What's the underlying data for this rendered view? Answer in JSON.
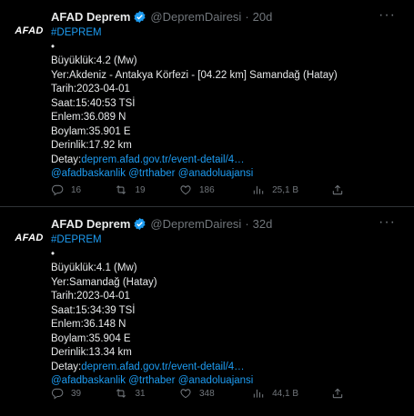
{
  "tweets": [
    {
      "avatar_text": "AFAD",
      "name": "AFAD Deprem",
      "handle": "@DepremDairesi",
      "sep": "·",
      "time": "20d",
      "more": "···",
      "hashtag": "#DEPREM",
      "bullet": "•",
      "lines": [
        "Büyüklük:4.2 (Mw)",
        "Yer:Akdeniz - Antakya Körfezi - [04.22 km] Samandağ (Hatay)",
        "Tarih:2023-04-01",
        "Saat:15:40:53 TSİ",
        "Enlem:36.089 N",
        "Boylam:35.901 E",
        "Derinlik:17.92 km"
      ],
      "detail_label": "Detay:",
      "detail_link": "deprem.afad.gov.tr/event-detail/4…",
      "mentions": "@afadbaskanlik @trthaber @anadoluajansi",
      "replies": "16",
      "retweets": "19",
      "likes": "186",
      "views": "25,1 B"
    },
    {
      "avatar_text": "AFAD",
      "name": "AFAD Deprem",
      "handle": "@DepremDairesi",
      "sep": "·",
      "time": "32d",
      "more": "···",
      "hashtag": "#DEPREM",
      "bullet": "•",
      "lines": [
        "Büyüklük:4.1 (Mw)",
        "Yer:Samandağ (Hatay)",
        "Tarih:2023-04-01",
        "Saat:15:34:39 TSİ",
        "Enlem:36.148 N",
        "Boylam:35.904 E",
        "Derinlik:13.34 km"
      ],
      "detail_label": "Detay:",
      "detail_link": "deprem.afad.gov.tr/event-detail/4…",
      "mentions": "@afadbaskanlik @trthaber @anadoluajansi",
      "replies": "39",
      "retweets": "31",
      "likes": "348",
      "views": "44,1 B"
    }
  ],
  "colors": {
    "link": "#1d9bf0",
    "muted": "#71767b",
    "text": "#e7e9ea",
    "divider": "#2f3336"
  }
}
